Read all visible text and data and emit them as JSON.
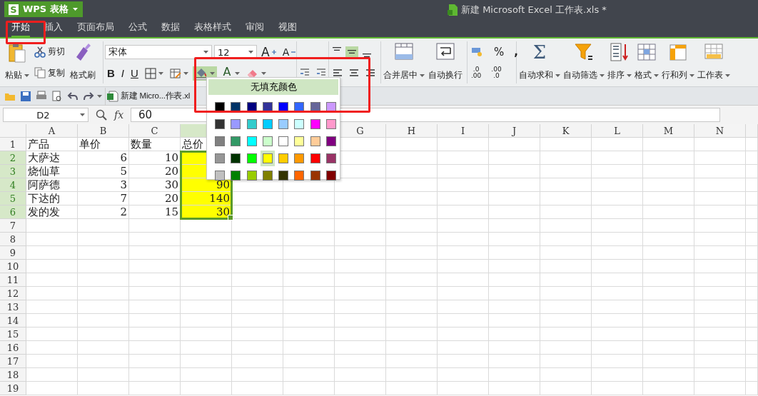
{
  "app_button": {
    "logo": "S",
    "label": "WPS 表格"
  },
  "title": "新建 Microsoft Excel 工作表.xls *",
  "tabs": [
    {
      "label": "开始",
      "selected": true,
      "annotated": true
    },
    {
      "label": "插入",
      "selected": false,
      "annotated": false
    },
    {
      "label": "页面布局",
      "selected": false,
      "annotated": false
    },
    {
      "label": "公式",
      "selected": false,
      "annotated": false
    },
    {
      "label": "数据",
      "selected": false,
      "annotated": false
    },
    {
      "label": "表格样式",
      "selected": false,
      "annotated": false
    },
    {
      "label": "审阅",
      "selected": false,
      "annotated": false
    },
    {
      "label": "视图",
      "selected": false,
      "annotated": false
    }
  ],
  "ribbon": {
    "paste": "粘贴",
    "cut": "剪切",
    "copy": "复制",
    "format_painter": "格式刷",
    "font_name": "宋体",
    "font_size": "12",
    "grow_font": "A",
    "shrink_font": "A",
    "bold": "B",
    "italic": "I",
    "underline": "U",
    "font_color": "A",
    "fill_expanded": true,
    "vertical_align": [
      {
        "selected": false
      },
      {
        "selected": true
      },
      {
        "selected": false
      }
    ],
    "merge": "合并居中",
    "wrap": "自动换行",
    "percent": "%",
    "comma": ",",
    "decimals": [
      {
        "top": ".0",
        "bottom": ".00"
      },
      {
        "top": ".00",
        "bottom": ".0"
      }
    ],
    "big_buttons": [
      {
        "kind": "sum",
        "glyph": "Σ",
        "label": "自动求和"
      },
      {
        "kind": "filter",
        "label": "自动筛选"
      },
      {
        "kind": "sort",
        "label": "排序"
      },
      {
        "kind": "format",
        "label": "格式"
      },
      {
        "kind": "rowcol",
        "label": "行和列"
      },
      {
        "kind": "sheet",
        "label": "工作表"
      }
    ]
  },
  "document_tab": "新建 Micro...作表.xl",
  "formula_bar": {
    "name_box": "D2",
    "fx": "fx",
    "value": "60"
  },
  "palette": {
    "no_fill": "无填充颜色",
    "annotated": true,
    "rows": [
      [
        {
          "color": "#000000",
          "selected": false
        },
        {
          "color": "#003366",
          "selected": false
        },
        {
          "color": "#000080",
          "selected": false
        },
        {
          "color": "#333399",
          "selected": false
        },
        {
          "color": "#0000ff",
          "selected": false
        },
        {
          "color": "#3366ff",
          "selected": false
        },
        {
          "color": "#666699",
          "selected": false
        },
        {
          "color": "#cc99ff",
          "selected": false
        }
      ],
      [
        {
          "color": "#333333",
          "selected": false
        },
        {
          "color": "#9999ff",
          "selected": false
        },
        {
          "color": "#33cccc",
          "selected": false
        },
        {
          "color": "#00ccff",
          "selected": false
        },
        {
          "color": "#99ccff",
          "selected": false
        },
        {
          "color": "#ccffff",
          "selected": false
        },
        {
          "color": "#ff00ff",
          "selected": false
        },
        {
          "color": "#ff99cc",
          "selected": false
        }
      ],
      [
        {
          "color": "#808080",
          "selected": false
        },
        {
          "color": "#339966",
          "selected": false
        },
        {
          "color": "#00ffff",
          "selected": false
        },
        {
          "color": "#ccffcc",
          "selected": false
        },
        {
          "color": "#ffffff",
          "selected": false
        },
        {
          "color": "#ffff99",
          "selected": false
        },
        {
          "color": "#ffcc99",
          "selected": false
        },
        {
          "color": "#800080",
          "selected": false
        }
      ],
      [
        {
          "color": "#969696",
          "selected": false
        },
        {
          "color": "#003300",
          "selected": false
        },
        {
          "color": "#00ff00",
          "selected": false
        },
        {
          "color": "#ffff00",
          "selected": true
        },
        {
          "color": "#ffcc00",
          "selected": false
        },
        {
          "color": "#ff9900",
          "selected": false
        },
        {
          "color": "#ff0000",
          "selected": false
        },
        {
          "color": "#993366",
          "selected": false
        }
      ],
      [
        {
          "color": "#c0c0c0",
          "selected": false
        },
        {
          "color": "#008000",
          "selected": false
        },
        {
          "color": "#99cc00",
          "selected": false
        },
        {
          "color": "#808000",
          "selected": false
        },
        {
          "color": "#333300",
          "selected": false
        },
        {
          "color": "#ff6600",
          "selected": false
        },
        {
          "color": "#993300",
          "selected": false
        },
        {
          "color": "#800000",
          "selected": false
        }
      ]
    ]
  },
  "sheet": {
    "columns": [
      {
        "label": "A",
        "selected": false
      },
      {
        "label": "B",
        "selected": false
      },
      {
        "label": "C",
        "selected": false
      },
      {
        "selected": true
      },
      null,
      null,
      {
        "label": "G",
        "selected": false
      },
      {
        "label": "H",
        "selected": false
      },
      {
        "label": "I",
        "selected": false
      },
      {
        "label": "J",
        "selected": false
      },
      {
        "label": "K",
        "selected": false
      },
      {
        "label": "L",
        "selected": false
      },
      {
        "label": "M",
        "selected": false
      },
      {
        "label": "N",
        "selected": false
      }
    ],
    "rows": [
      {
        "number": "1",
        "selected": false,
        "cells": [
          {
            "text": "产品",
            "kind": "text"
          },
          {
            "text": "单价",
            "kind": "text"
          },
          {
            "text": "数量",
            "kind": "text"
          },
          {
            "text": "总价",
            "kind": "text"
          }
        ]
      },
      {
        "number": "2",
        "selected": true,
        "cells": [
          {
            "text": "大萨达",
            "kind": "text"
          },
          {
            "text": "6",
            "kind": "number"
          },
          {
            "text": "10",
            "kind": "number"
          },
          {
            "kind": "number",
            "color": "#ffff00"
          }
        ]
      },
      {
        "number": "3",
        "selected": true,
        "cells": [
          {
            "text": "烧仙草",
            "kind": "text"
          },
          {
            "text": "5",
            "kind": "number"
          },
          {
            "text": "20",
            "kind": "number"
          },
          {
            "kind": "number",
            "color": "#ffff00"
          }
        ]
      },
      {
        "number": "4",
        "selected": true,
        "cells": [
          {
            "text": "阿萨德",
            "kind": "text"
          },
          {
            "text": "3",
            "kind": "number"
          },
          {
            "text": "30",
            "kind": "number"
          },
          {
            "text": "90",
            "kind": "number",
            "color": "#ffff00"
          }
        ]
      },
      {
        "number": "5",
        "selected": true,
        "cells": [
          {
            "text": "下达的",
            "kind": "text"
          },
          {
            "text": "7",
            "kind": "number"
          },
          {
            "text": "20",
            "kind": "number"
          },
          {
            "text": "140",
            "kind": "number",
            "color": "#ffff00"
          }
        ]
      },
      {
        "number": "6",
        "selected": true,
        "cells": [
          {
            "text": "发的发",
            "kind": "text"
          },
          {
            "text": "2",
            "kind": "number"
          },
          {
            "text": "15",
            "kind": "number"
          },
          {
            "text": "30",
            "kind": "number",
            "color": "#ffff00"
          }
        ]
      },
      {
        "number": "7",
        "selected": false
      },
      {
        "number": "8",
        "selected": false
      },
      {
        "number": "9",
        "selected": false
      },
      {
        "number": "10",
        "selected": false
      },
      {
        "number": "11",
        "selected": false
      },
      {
        "number": "12",
        "selected": false
      },
      {
        "number": "13",
        "selected": false
      },
      {
        "number": "14",
        "selected": false
      },
      {
        "number": "15",
        "selected": false
      },
      {
        "number": "16",
        "selected": false
      },
      {
        "number": "17",
        "selected": false
      },
      {
        "number": "18",
        "selected": false
      },
      {
        "number": "19",
        "selected": false
      }
    ]
  }
}
